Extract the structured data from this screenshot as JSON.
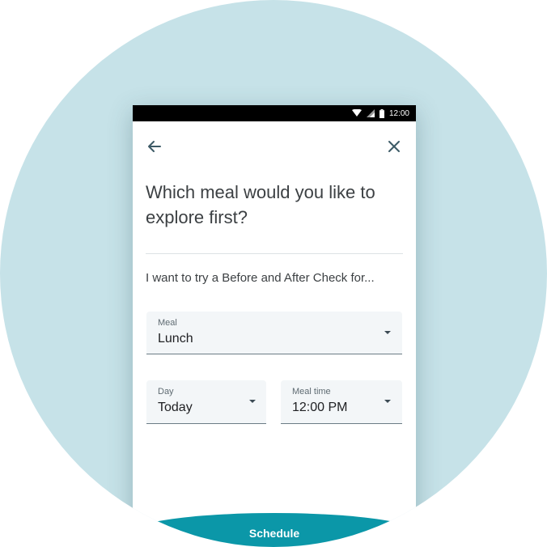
{
  "status_bar": {
    "time": "12:00",
    "icons": [
      "wifi-icon",
      "signal-icon",
      "battery-icon"
    ]
  },
  "header": {
    "back_icon": "arrow-left-icon",
    "close_icon": "close-icon"
  },
  "title": "Which meal would you like to explore first?",
  "prompt": "I want to try a Before and After Check for...",
  "fields": {
    "meal": {
      "label": "Meal",
      "value": "Lunch"
    },
    "day": {
      "label": "Day",
      "value": "Today"
    },
    "meal_time": {
      "label": "Meal time",
      "value": "12:00 PM"
    }
  },
  "schedule_button": {
    "label": "Schedule"
  },
  "colors": {
    "background_circle": "#c6e2e8",
    "accent": "#0b97a8",
    "field_bg": "#f3f6f8"
  }
}
